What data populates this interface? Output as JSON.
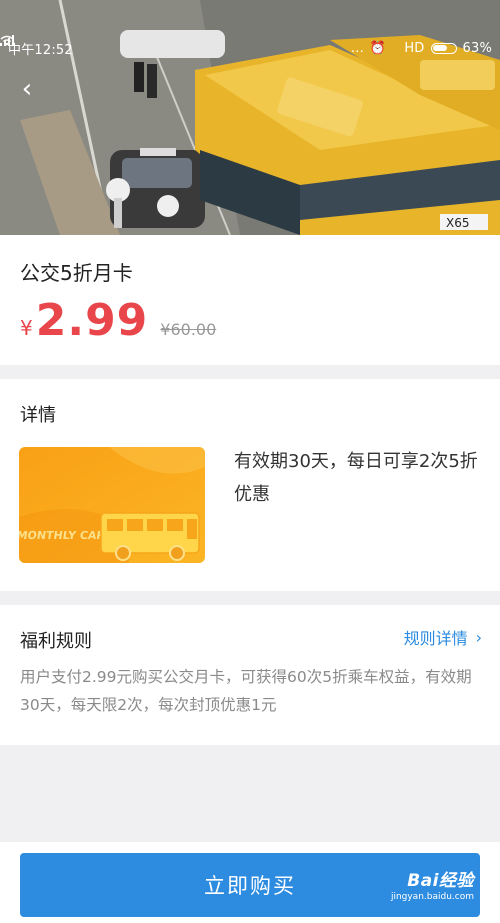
{
  "status_bar": {
    "time": "中午12:52",
    "dots": "...",
    "signal_label": "HD",
    "battery_text": "63%"
  },
  "hero": {
    "bus_plate_text": "X65"
  },
  "product": {
    "title": "公交5折月卡",
    "currency": "¥",
    "price": "2.99",
    "original_price": "¥60.00"
  },
  "details": {
    "section_title": "详情",
    "card_text": "MONTHLY CARD",
    "description": "有效期30天，每日可享2次5折优惠"
  },
  "rules": {
    "section_title": "福利规则",
    "link_label": "规则详情",
    "text": "用户支付2.99元购买公交月卡，可获得60次5折乘车权益，有效期30天，每天限2次，每次封顶优惠1元"
  },
  "footer": {
    "buy_label": "立即购买",
    "watermark_brand": "Bai经验",
    "watermark_url": "jingyan.baidu.com"
  },
  "colors": {
    "accent": "#2d8ce0",
    "price": "#e8464a",
    "card_orange": "#f7a318",
    "bus_yellow": "#e8b52a"
  },
  "icons": [
    "back-arrow-icon",
    "alarm-icon",
    "wifi-icon",
    "signal-icon",
    "battery-icon",
    "chevron-right-icon",
    "bus-icon",
    "baidu-paw-icon"
  ]
}
